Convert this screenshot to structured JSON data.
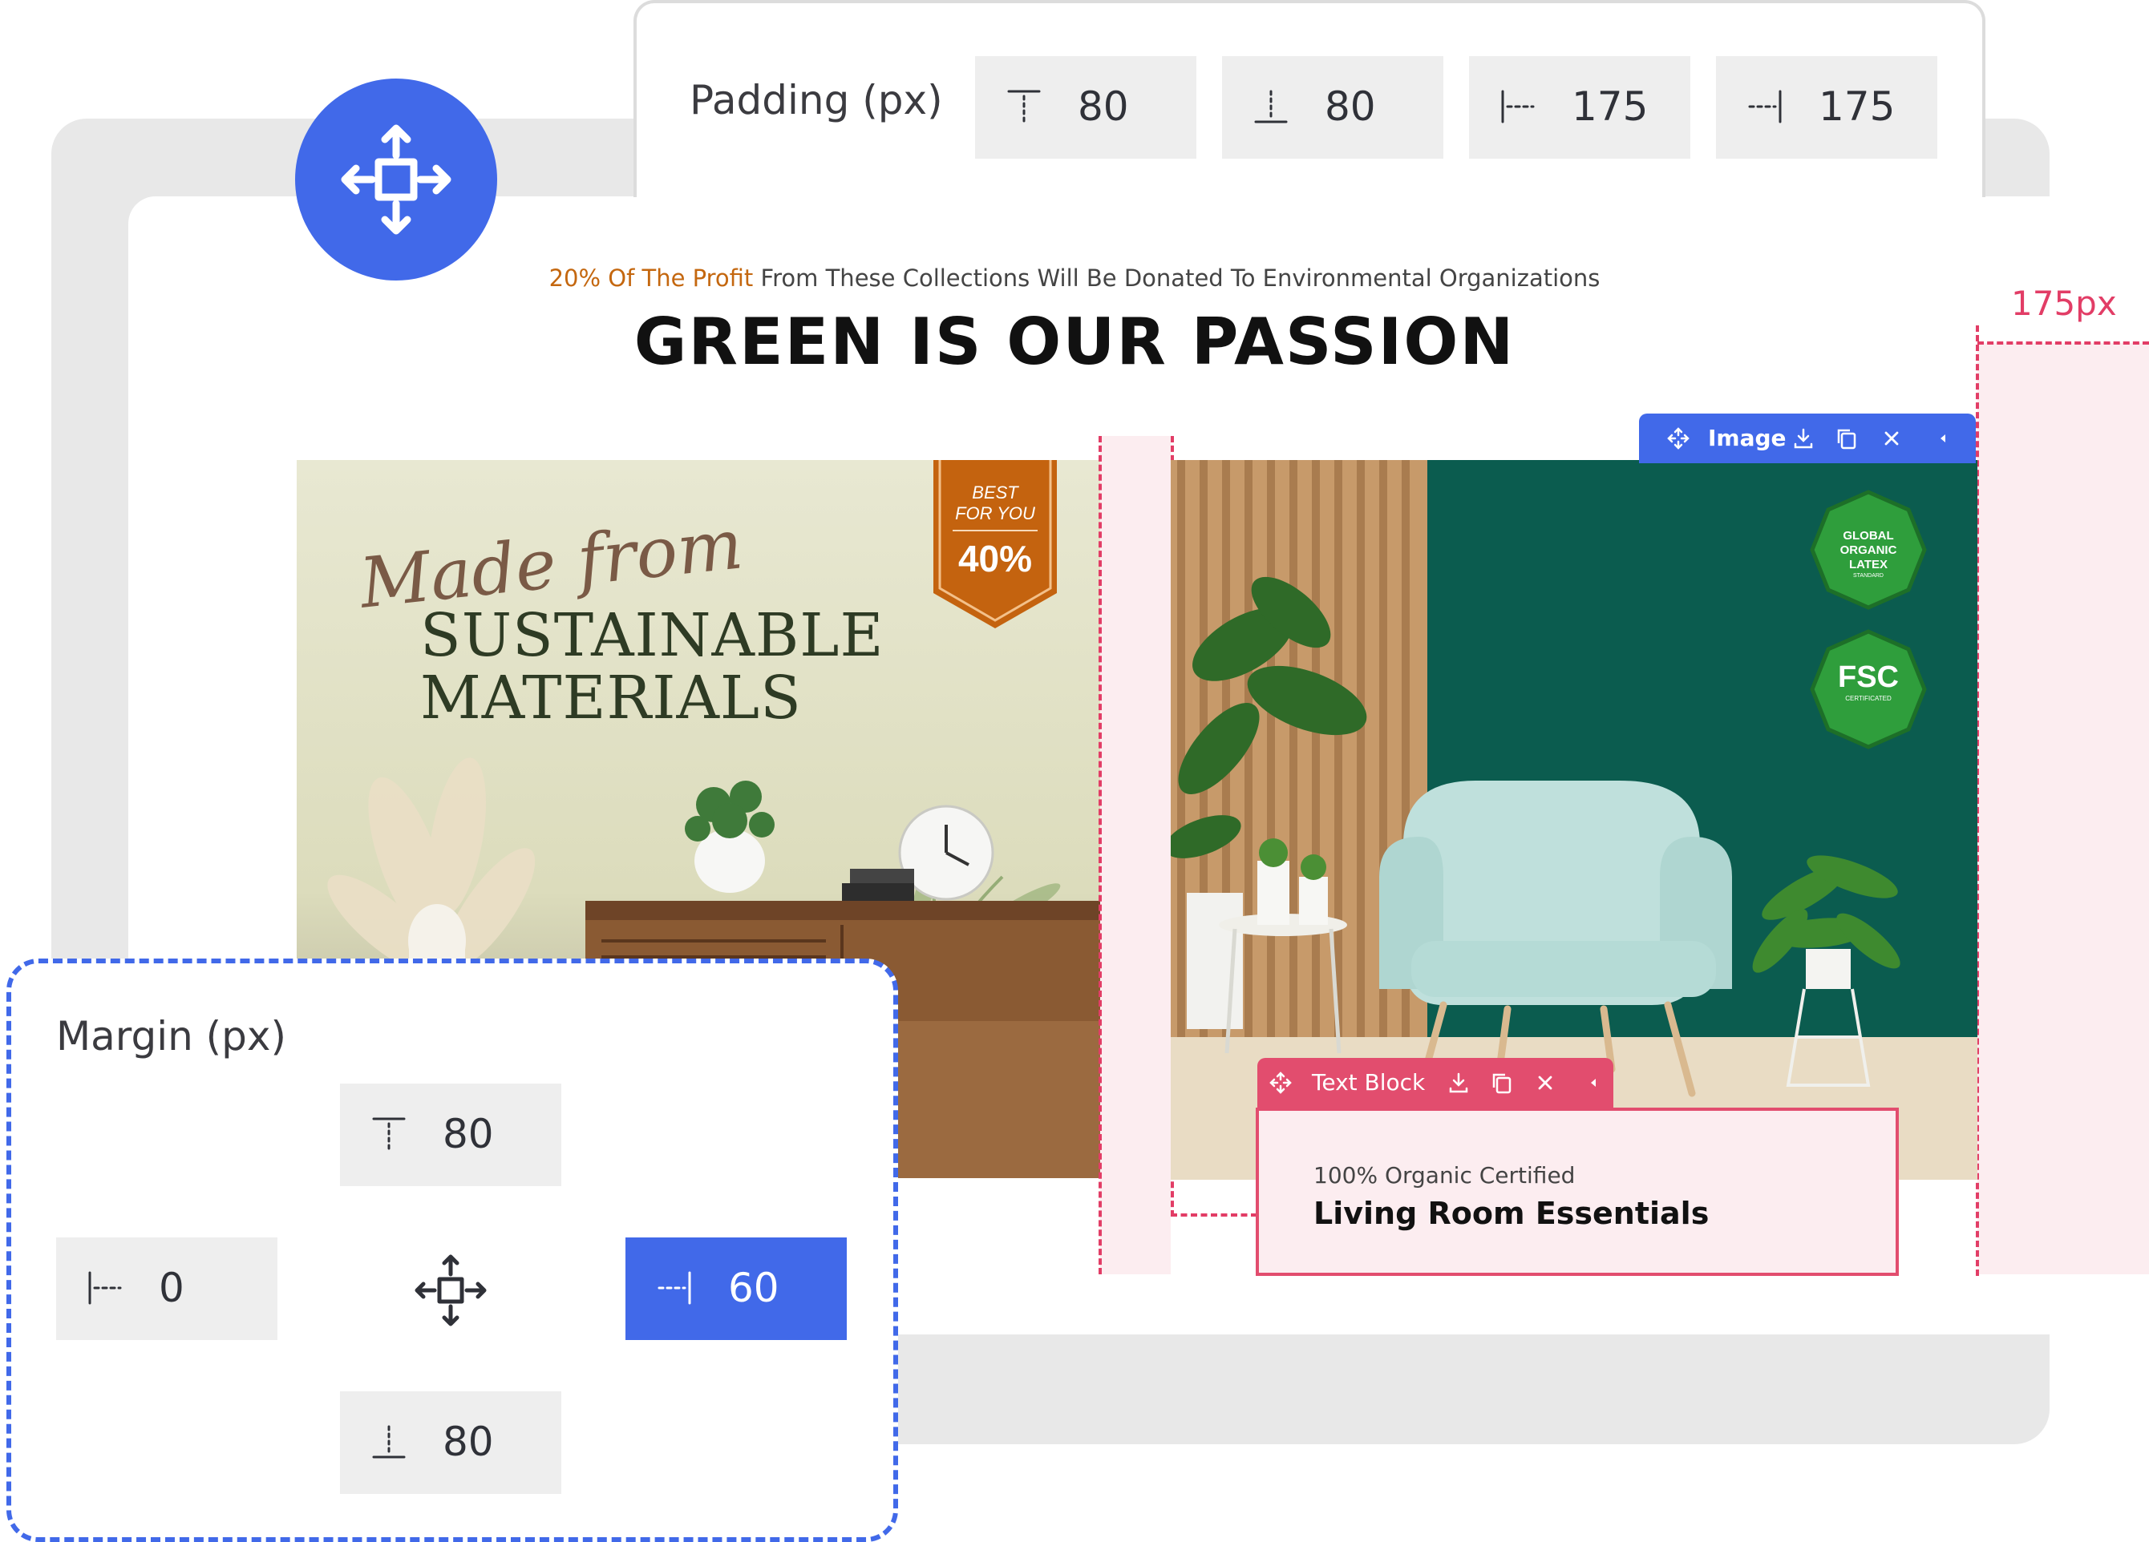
{
  "padding_panel": {
    "label": "Padding (px)",
    "top": "80",
    "bottom": "80",
    "left": "175",
    "right": "175"
  },
  "header": {
    "promo_highlight": "20% Of The Profit",
    "promo_rest": " From These Collections Will Be Donated To Environmental Organizations",
    "headline": "GREEN IS OUR PASSION"
  },
  "banner_left": {
    "script_text": "Made from",
    "title_line1": "SUSTAINABLE",
    "title_line2": "MATERIALS",
    "badge_line1": "BEST",
    "badge_line2": "FOR YOU",
    "badge_value": "40%"
  },
  "banner_right": {
    "cert1_line1": "GLOBAL",
    "cert1_line2": "ORGANIC",
    "cert1_line3": "LATEX",
    "cert1_line4": "STANDARD",
    "cert2_title": "FSC",
    "cert2_sub": "CERTIFICATED"
  },
  "image_toolbar": {
    "label": "Image"
  },
  "text_block_toolbar": {
    "label": "Text Block"
  },
  "text_block": {
    "subtitle": "100% Organic Certified",
    "title": "Living Room Essentials"
  },
  "guide_label": "175px",
  "margin_panel": {
    "label": "Margin (px)",
    "top": "80",
    "bottom": "80",
    "left": "0",
    "right": "60"
  },
  "colors": {
    "accent_blue": "#4169e9",
    "guide_pink": "#e23d66",
    "promo_orange": "#c4670f",
    "badge_orange": "#c4630f",
    "cert_green": "#2f9e3c"
  }
}
